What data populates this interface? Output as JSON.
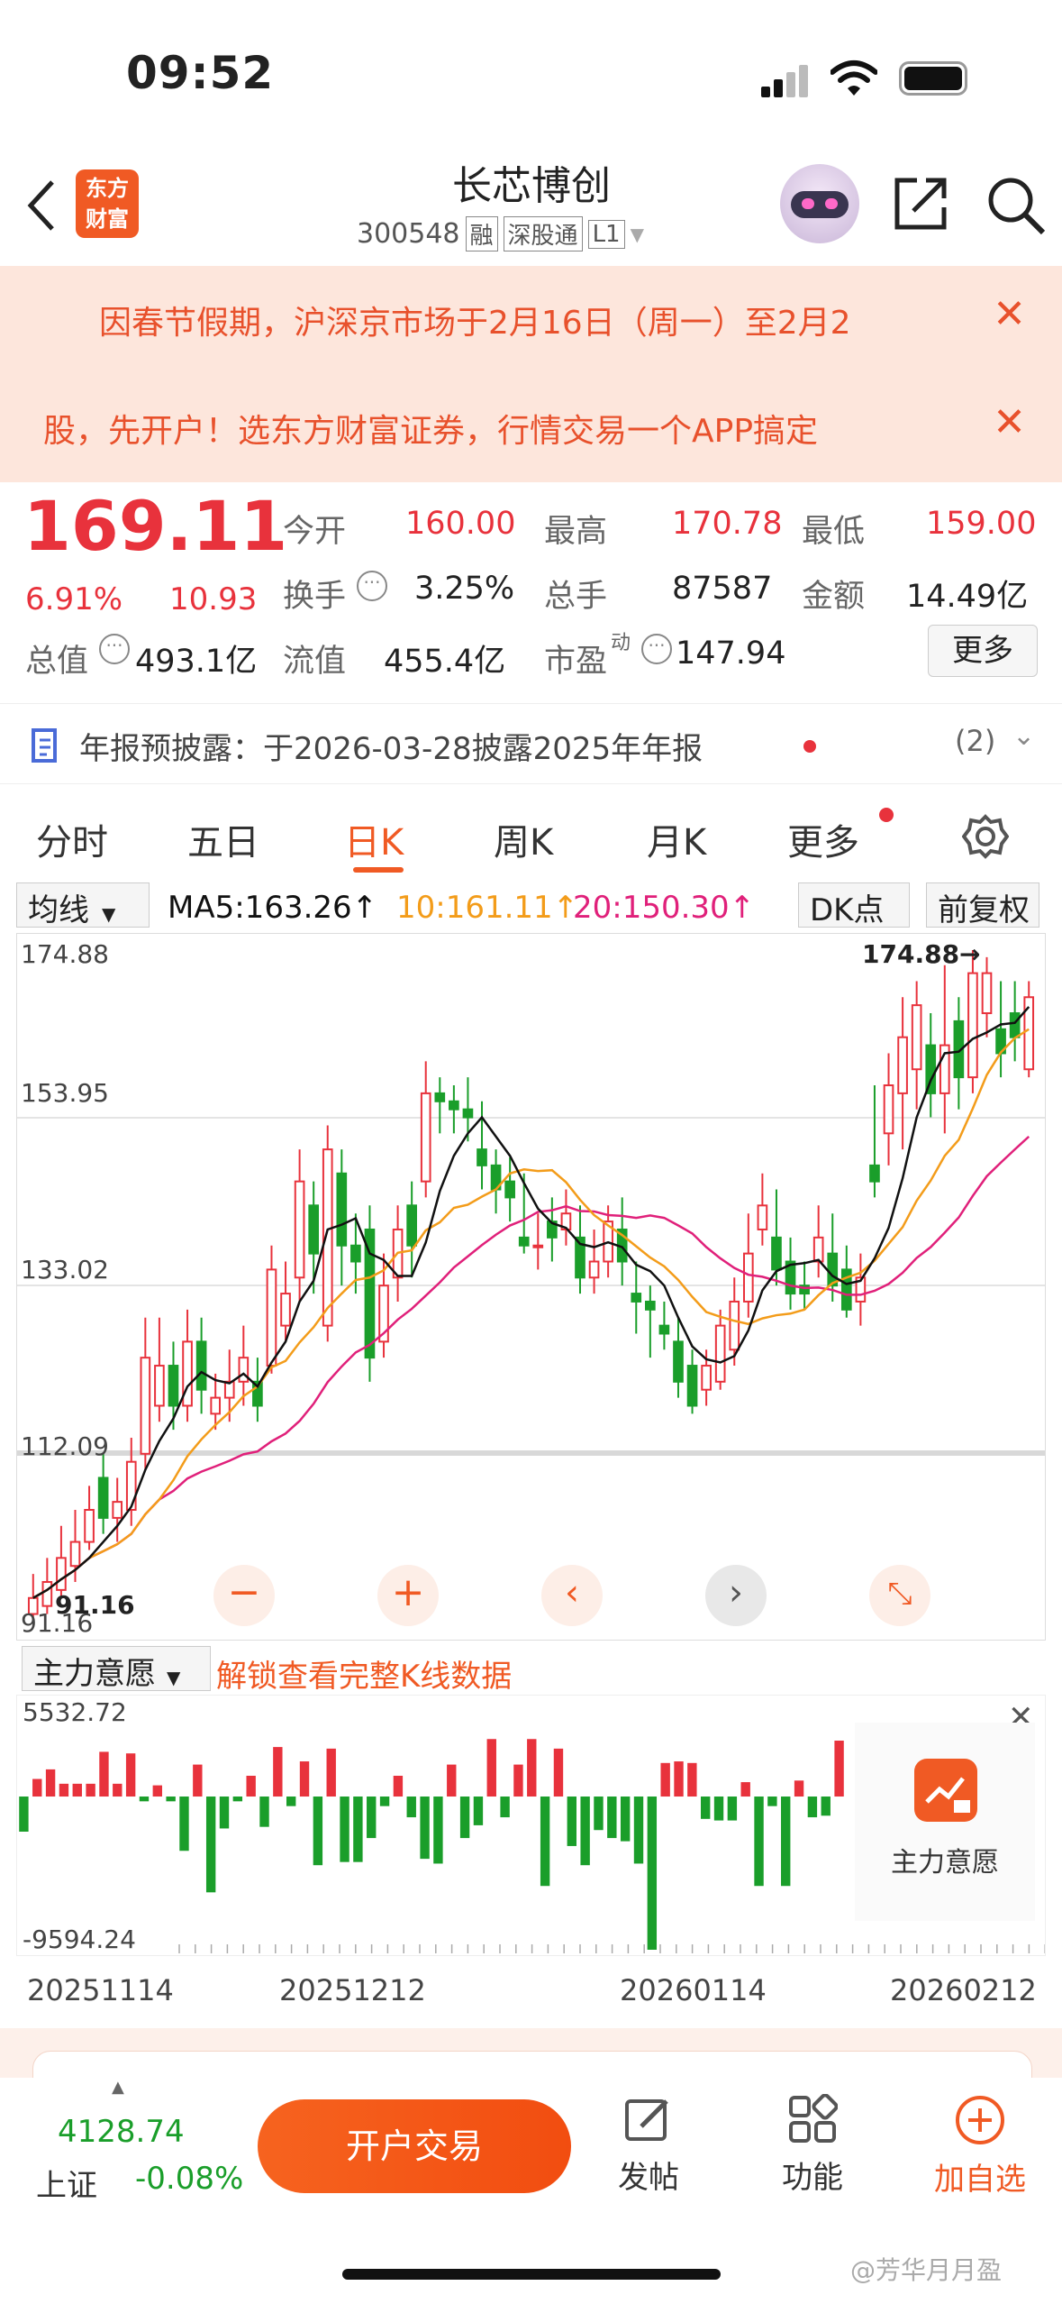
{
  "status": {
    "time": "09:52"
  },
  "nav": {
    "title": "长芯博创",
    "code": "300548",
    "tags": [
      "融",
      "深股通",
      "L1"
    ],
    "logo_line1": "东方",
    "logo_line2": "财富"
  },
  "banners": [
    {
      "text": "因春节假期，沪深京市场于2月16日（周一）至2月2"
    },
    {
      "text": "股，先开户！选东方财富证券，行情交易一个APP搞定"
    }
  ],
  "quote": {
    "price": "169.11",
    "pct": "6.91%",
    "change": "10.93",
    "open_label": "今开",
    "open": "160.00",
    "high_label": "最高",
    "high": "170.78",
    "low_label": "最低",
    "low": "159.00",
    "turnover_label": "换手",
    "turnover": "3.25%",
    "volume_label": "总手",
    "volume": "87587",
    "amount_label": "金额",
    "amount": "14.49亿",
    "mcap_label": "总值",
    "mcap": "493.1亿",
    "float_label": "流值",
    "float": "455.4亿",
    "pe_label": "市盈",
    "pe_sup": "动",
    "pe": "147.94",
    "more": "更多"
  },
  "notice": {
    "text": "年报预披露：于2026-03-28披露2025年年报",
    "count": "(2)"
  },
  "tabs": [
    "分时",
    "五日",
    "日K",
    "周K",
    "月K",
    "更多"
  ],
  "active_tab": "日K",
  "chartbar": {
    "ma_select": "均线",
    "ma5": "MA5:163.26↑",
    "ma10": "10:161.11↑",
    "ma20": "20:150.30↑",
    "dk": "DK点",
    "adj": "前复权"
  },
  "chart_data": {
    "type": "candlestick",
    "y_ticks": [
      "174.88",
      "153.95",
      "133.02",
      "112.09",
      "91.16"
    ],
    "high_marker": "174.88→",
    "low_marker": "91.16",
    "ylim": [
      91.16,
      174.88
    ],
    "candles": [
      {
        "o": 92,
        "c": 94,
        "h": 97,
        "l": 91.2
      },
      {
        "o": 93,
        "c": 96,
        "h": 99,
        "l": 92
      },
      {
        "o": 95,
        "c": 99,
        "h": 103,
        "l": 94
      },
      {
        "o": 98,
        "c": 101,
        "h": 105,
        "l": 96
      },
      {
        "o": 101,
        "c": 105,
        "h": 108,
        "l": 100
      },
      {
        "o": 109,
        "c": 104,
        "h": 112,
        "l": 102
      },
      {
        "o": 104,
        "c": 106,
        "h": 109,
        "l": 101
      },
      {
        "o": 105,
        "c": 111,
        "h": 114,
        "l": 103
      },
      {
        "o": 112,
        "c": 124,
        "h": 129,
        "l": 110
      },
      {
        "o": 118,
        "c": 123,
        "h": 129,
        "l": 116
      },
      {
        "o": 123,
        "c": 118,
        "h": 126,
        "l": 115
      },
      {
        "o": 118,
        "c": 126,
        "h": 130,
        "l": 116
      },
      {
        "o": 126,
        "c": 120,
        "h": 129,
        "l": 117
      },
      {
        "o": 117,
        "c": 119,
        "h": 122,
        "l": 115
      },
      {
        "o": 119,
        "c": 121,
        "h": 125,
        "l": 116
      },
      {
        "o": 121,
        "c": 124,
        "h": 128,
        "l": 118
      },
      {
        "o": 121,
        "c": 118,
        "h": 124,
        "l": 116
      },
      {
        "o": 123,
        "c": 135,
        "h": 138,
        "l": 122
      },
      {
        "o": 128,
        "c": 132,
        "h": 136,
        "l": 126
      },
      {
        "o": 134,
        "c": 146,
        "h": 150,
        "l": 131
      },
      {
        "o": 143,
        "c": 137,
        "h": 146,
        "l": 132
      },
      {
        "o": 128,
        "c": 150,
        "h": 153,
        "l": 126
      },
      {
        "o": 147,
        "c": 138,
        "h": 150,
        "l": 133
      },
      {
        "o": 138,
        "c": 136,
        "h": 142,
        "l": 132
      },
      {
        "o": 140,
        "c": 124,
        "h": 143,
        "l": 121
      },
      {
        "o": 126,
        "c": 133,
        "h": 137,
        "l": 124
      },
      {
        "o": 134,
        "c": 140,
        "h": 143,
        "l": 131
      },
      {
        "o": 143,
        "c": 138,
        "h": 146,
        "l": 134
      },
      {
        "o": 146,
        "c": 157,
        "h": 161,
        "l": 144
      },
      {
        "o": 157,
        "c": 156,
        "h": 159,
        "l": 152
      },
      {
        "o": 156,
        "c": 155,
        "h": 158,
        "l": 152
      },
      {
        "o": 155,
        "c": 154,
        "h": 159,
        "l": 151
      },
      {
        "o": 150,
        "c": 148,
        "h": 156,
        "l": 145
      },
      {
        "o": 148,
        "c": 145,
        "h": 150,
        "l": 142
      },
      {
        "o": 146,
        "c": 144,
        "h": 149,
        "l": 141
      },
      {
        "o": 139,
        "c": 138,
        "h": 147,
        "l": 137
      },
      {
        "o": 138,
        "c": 138,
        "h": 142,
        "l": 135
      },
      {
        "o": 141,
        "c": 139,
        "h": 144,
        "l": 136
      },
      {
        "o": 140,
        "c": 142,
        "h": 145,
        "l": 138
      },
      {
        "o": 139,
        "c": 134,
        "h": 143,
        "l": 132
      },
      {
        "o": 134,
        "c": 136,
        "h": 140,
        "l": 132
      },
      {
        "o": 136,
        "c": 141,
        "h": 143,
        "l": 134
      },
      {
        "o": 140,
        "c": 136,
        "h": 144,
        "l": 133
      },
      {
        "o": 132,
        "c": 131,
        "h": 136,
        "l": 127
      },
      {
        "o": 131,
        "c": 130,
        "h": 133,
        "l": 124
      },
      {
        "o": 128,
        "c": 127,
        "h": 131,
        "l": 125
      },
      {
        "o": 126,
        "c": 121,
        "h": 129,
        "l": 119
      },
      {
        "o": 123,
        "c": 118,
        "h": 125,
        "l": 117
      },
      {
        "o": 120,
        "c": 123,
        "h": 125,
        "l": 118
      },
      {
        "o": 121,
        "c": 128,
        "h": 130,
        "l": 120
      },
      {
        "o": 125,
        "c": 131,
        "h": 134,
        "l": 123
      },
      {
        "o": 131,
        "c": 137,
        "h": 142,
        "l": 129
      },
      {
        "o": 140,
        "c": 143,
        "h": 147,
        "l": 138
      },
      {
        "o": 139,
        "c": 135,
        "h": 145,
        "l": 133
      },
      {
        "o": 136,
        "c": 132,
        "h": 139,
        "l": 130
      },
      {
        "o": 133,
        "c": 132,
        "h": 136,
        "l": 130
      },
      {
        "o": 136,
        "c": 139,
        "h": 143,
        "l": 134
      },
      {
        "o": 137,
        "c": 133,
        "h": 142,
        "l": 131
      },
      {
        "o": 135,
        "c": 130,
        "h": 138,
        "l": 129
      },
      {
        "o": 131,
        "c": 134,
        "h": 137,
        "l": 128
      },
      {
        "o": 148,
        "c": 146,
        "h": 158,
        "l": 144
      },
      {
        "o": 152,
        "c": 158,
        "h": 162,
        "l": 148
      },
      {
        "o": 157,
        "c": 164,
        "h": 169,
        "l": 150
      },
      {
        "o": 160,
        "c": 168,
        "h": 171,
        "l": 155
      },
      {
        "o": 163,
        "c": 157,
        "h": 167,
        "l": 154
      },
      {
        "o": 157,
        "c": 163,
        "h": 173,
        "l": 152
      },
      {
        "o": 166,
        "c": 159,
        "h": 169,
        "l": 155
      },
      {
        "o": 159,
        "c": 172,
        "h": 174.88,
        "l": 157
      },
      {
        "o": 167,
        "c": 172,
        "h": 174,
        "l": 164
      },
      {
        "o": 165,
        "c": 162,
        "h": 171,
        "l": 159
      },
      {
        "o": 167,
        "c": 164,
        "h": 171,
        "l": 161
      },
      {
        "o": 160,
        "c": 169,
        "h": 171,
        "l": 159
      }
    ]
  },
  "controls": [
    "minus-icon",
    "plus-icon",
    "chevron-left-icon",
    "chevron-right-icon",
    "expand-icon"
  ],
  "indicator": {
    "select": "主力意愿",
    "unlock": "解锁查看完整K线数据",
    "max": "5532.72",
    "min": "-9594.24",
    "badge": "主力意愿",
    "values": [
      -2200,
      1100,
      1700,
      800,
      800,
      800,
      2800,
      800,
      2700,
      -300,
      700,
      -300,
      -3400,
      2000,
      -6000,
      -2000,
      -300,
      1300,
      -1900,
      3100,
      -600,
      2200,
      -4300,
      3000,
      -4100,
      -4100,
      -2600,
      -600,
      1300,
      -1300,
      -3900,
      -4200,
      2000,
      -2600,
      -1800,
      3600,
      -1300,
      2000,
      3600,
      -5600,
      3000,
      -3100,
      -4300,
      -2100,
      -2600,
      -2800,
      -4200,
      -9594,
      2100,
      2200,
      2100,
      -1400,
      -1500,
      -1500,
      900,
      -5600,
      -600,
      -5600,
      1000,
      -1300,
      -1200,
      3500
    ],
    "color_up": "#e8323c",
    "color_down": "#1a9e2a"
  },
  "dates": [
    "20251114",
    "20251212",
    "20260114",
    "20260212"
  ],
  "bottom": {
    "index_value": "4128.74",
    "index_name": "上证",
    "index_change": "-0.08%",
    "trade_btn": "开户交易",
    "post": "发帖",
    "func": "功能",
    "add": "加自选"
  },
  "watermark": "@芳华月月盈"
}
